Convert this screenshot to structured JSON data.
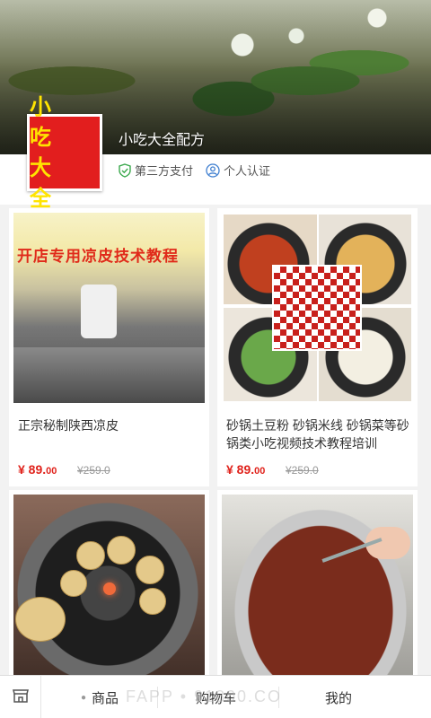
{
  "shop": {
    "logo_line1": "小 吃",
    "logo_line2": "大 全",
    "name": "小吃大全配方",
    "badge1": "第三方支付",
    "badge2": "个人认证"
  },
  "products": [
    {
      "title": "正宗秘制陕西凉皮",
      "price": "¥ 89.",
      "price_cents": "00",
      "old_price": "¥259.0",
      "image_text": "开店专用凉皮技术教程"
    },
    {
      "title": "砂锅土豆粉 砂锅米线 砂锅菜等砂锅类小吃视频技术教程培训",
      "price": "¥ 89.",
      "price_cents": "00",
      "old_price": "¥259.0"
    },
    {
      "title": "",
      "price": "",
      "old_price": ""
    },
    {
      "title": "",
      "price": "",
      "old_price": ""
    }
  ],
  "nav": {
    "goods": "商品",
    "cart": "购物车",
    "mine": "我的",
    "watermark": "FAPP • 91800.CO"
  }
}
